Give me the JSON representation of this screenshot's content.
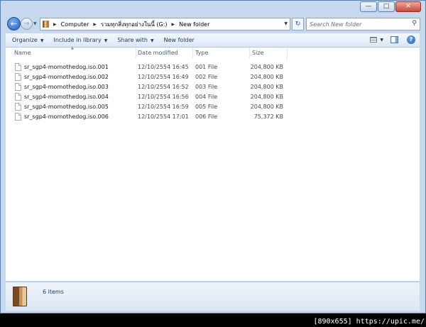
{
  "window": {
    "minimize_glyph": "—",
    "maximize_glyph": "□",
    "close_glyph": "✕"
  },
  "nav": {
    "back_glyph": "←",
    "forward_glyph": "→",
    "breadcrumb": [
      "Computer",
      "รวมทุกสิ่งทุกอย่างในนี้ (G:)",
      "New folder"
    ],
    "refresh_glyph": "↻",
    "search_placeholder": "Search New folder"
  },
  "toolbar": {
    "organize": "Organize",
    "include_in_library": "Include in library",
    "share_with": "Share with",
    "new_folder": "New folder"
  },
  "columns": {
    "name": "Name",
    "date_modified": "Date modified",
    "type": "Type",
    "size": "Size"
  },
  "files": [
    {
      "name": "sr_sgp4-momothedog.iso.001",
      "date": "12/10/2554 16:45",
      "type": "001 File",
      "size": "204,800 KB"
    },
    {
      "name": "sr_sgp4-momothedog.iso.002",
      "date": "12/10/2554 16:49",
      "type": "002 File",
      "size": "204,800 KB"
    },
    {
      "name": "sr_sgp4-momothedog.iso.003",
      "date": "12/10/2554 16:52",
      "type": "003 File",
      "size": "204,800 KB"
    },
    {
      "name": "sr_sgp4-momothedog.iso.004",
      "date": "12/10/2554 16:56",
      "type": "004 File",
      "size": "204,800 KB"
    },
    {
      "name": "sr_sgp4-momothedog.iso.005",
      "date": "12/10/2554 16:59",
      "type": "005 File",
      "size": "204,800 KB"
    },
    {
      "name": "sr_sgp4-momothedog.iso.006",
      "date": "12/10/2554 17:01",
      "type": "006 File",
      "size": "75,372 KB"
    }
  ],
  "details": {
    "item_count": "6 items",
    "icon": "drive-icon"
  },
  "watermark": "[890x655] https://upic.me/",
  "colors": {
    "chrome": "#c5d8ee",
    "accent": "#1f5fb5",
    "close": "#c74a37"
  }
}
